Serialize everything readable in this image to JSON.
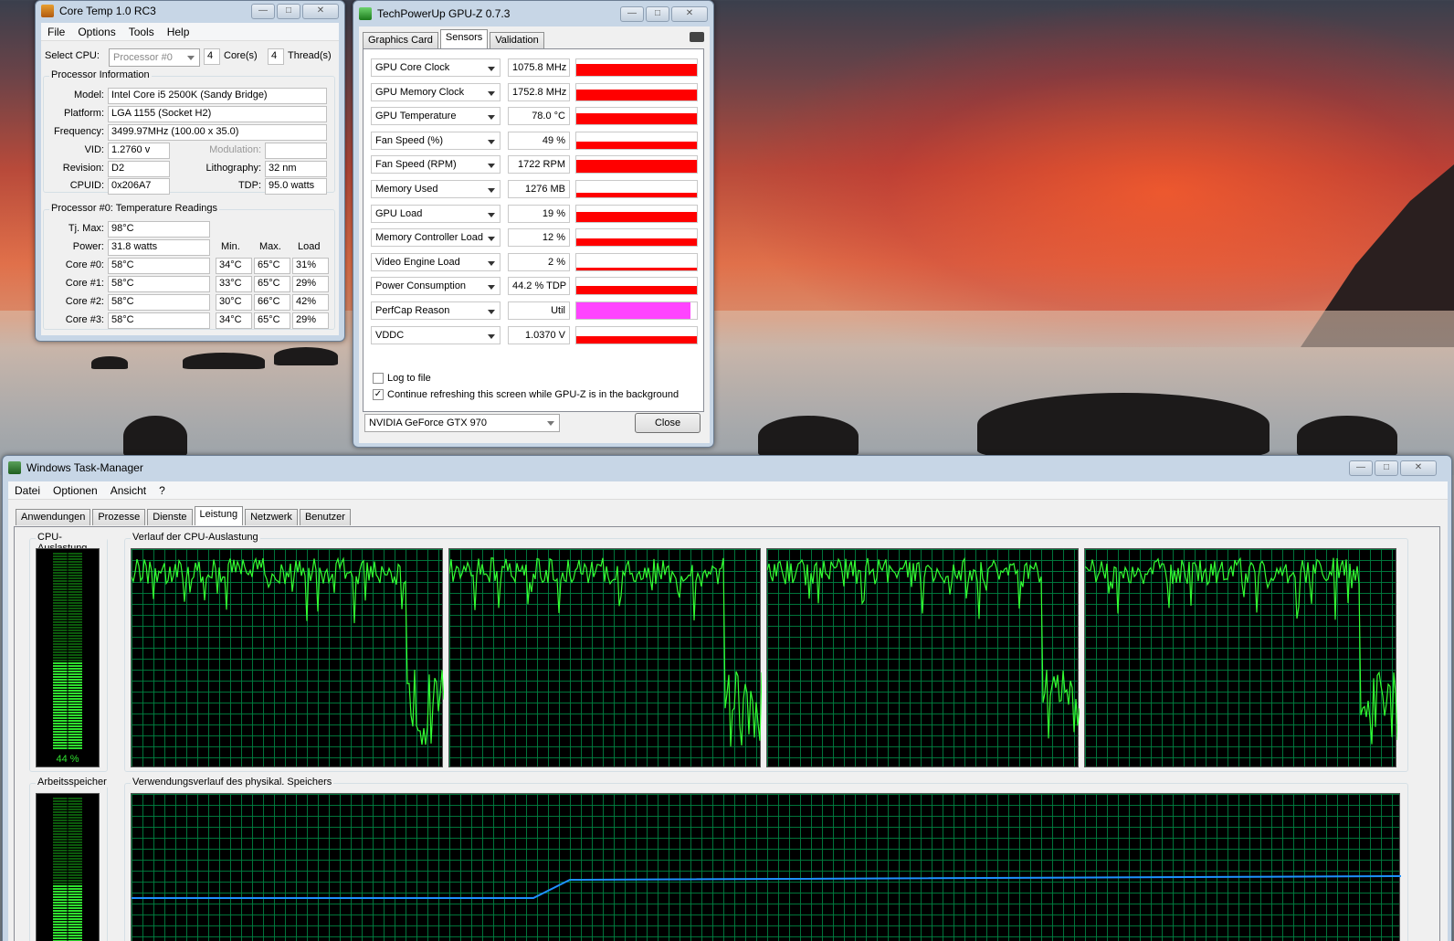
{
  "coretemp": {
    "title": "Core Temp 1.0 RC3",
    "menu": [
      "File",
      "Options",
      "Tools",
      "Help"
    ],
    "select_cpu_label": "Select CPU:",
    "processor_select": "Processor #0",
    "cores_value": "4",
    "cores_label": "Core(s)",
    "threads_value": "4",
    "threads_label": "Thread(s)",
    "info_group": "Processor Information",
    "model_label": "Model:",
    "model": "Intel Core i5 2500K (Sandy Bridge)",
    "platform_label": "Platform:",
    "platform": "LGA 1155 (Socket H2)",
    "frequency_label": "Frequency:",
    "frequency": "3499.97MHz (100.00 x 35.0)",
    "vid_label": "VID:",
    "vid": "1.2760 v",
    "modulation_label": "Modulation:",
    "modulation": "",
    "revision_label": "Revision:",
    "revision": "D2",
    "lithography_label": "Lithography:",
    "lithography": "32 nm",
    "cpuid_label": "CPUID:",
    "cpuid": "0x206A7",
    "tdp_label": "TDP:",
    "tdp": "95.0 watts",
    "temp_group": "Processor #0: Temperature Readings",
    "tjmax_label": "Tj. Max:",
    "tjmax": "98°C",
    "power_label": "Power:",
    "power": "31.8 watts",
    "col_min": "Min.",
    "col_max": "Max.",
    "col_load": "Load",
    "cores": [
      {
        "label": "Core #0:",
        "temp": "58°C",
        "min": "34°C",
        "max": "65°C",
        "load": "31%"
      },
      {
        "label": "Core #1:",
        "temp": "58°C",
        "min": "33°C",
        "max": "65°C",
        "load": "29%"
      },
      {
        "label": "Core #2:",
        "temp": "58°C",
        "min": "30°C",
        "max": "66°C",
        "load": "42%"
      },
      {
        "label": "Core #3:",
        "temp": "58°C",
        "min": "34°C",
        "max": "65°C",
        "load": "29%"
      }
    ]
  },
  "gpuz": {
    "title": "TechPowerUp GPU-Z 0.7.3",
    "tabs": [
      "Graphics Card",
      "Sensors",
      "Validation"
    ],
    "active_tab": "Sensors",
    "sensors": [
      {
        "name": "GPU Core Clock",
        "value": "1075.8 MHz",
        "level": 0.75
      },
      {
        "name": "GPU Memory Clock",
        "value": "1752.8 MHz",
        "level": 0.65
      },
      {
        "name": "GPU Temperature",
        "value": "78.0 °C",
        "level": 0.7
      },
      {
        "name": "Fan Speed (%)",
        "value": "49 %",
        "level": 0.45
      },
      {
        "name": "Fan Speed (RPM)",
        "value": "1722 RPM",
        "level": 0.8
      },
      {
        "name": "Memory Used",
        "value": "1276 MB",
        "level": 0.3
      },
      {
        "name": "GPU Load",
        "value": "19 %",
        "level": 0.6
      },
      {
        "name": "Memory Controller Load",
        "value": "12 %",
        "level": 0.45
      },
      {
        "name": "Video Engine Load",
        "value": "2 %",
        "level": 0.15
      },
      {
        "name": "Power Consumption",
        "value": "44.2 % TDP",
        "level": 0.5
      },
      {
        "name": "PerfCap Reason",
        "value": "Util",
        "level": 1.0,
        "color": "#ff44ff"
      },
      {
        "name": "VDDC",
        "value": "1.0370 V",
        "level": 0.4
      }
    ],
    "log_to_file": "Log to file",
    "continue_refresh": "Continue refreshing this screen while GPU-Z is in the background",
    "gpu_select": "NVIDIA GeForce GTX 970",
    "close_label": "Close"
  },
  "taskmgr": {
    "title": "Windows Task-Manager",
    "menu": [
      "Datei",
      "Optionen",
      "Ansicht",
      "?"
    ],
    "tabs": [
      "Anwendungen",
      "Prozesse",
      "Dienste",
      "Leistung",
      "Netzwerk",
      "Benutzer"
    ],
    "active_tab": "Leistung",
    "cpu_usage_title": "CPU-Auslastung",
    "cpu_usage_value": "44 %",
    "cpu_usage_level": 0.44,
    "cpu_history_title": "Verlauf der CPU-Auslastung",
    "mem_title": "Arbeitsspeicher",
    "mem_level": 0.45,
    "mem_history_title": "Verwendungsverlauf des physikal. Speichers"
  },
  "colors": {
    "cpu_line": "#33ff33",
    "mem_line": "#1e90ff",
    "sensor_bar": "#ff0000"
  }
}
